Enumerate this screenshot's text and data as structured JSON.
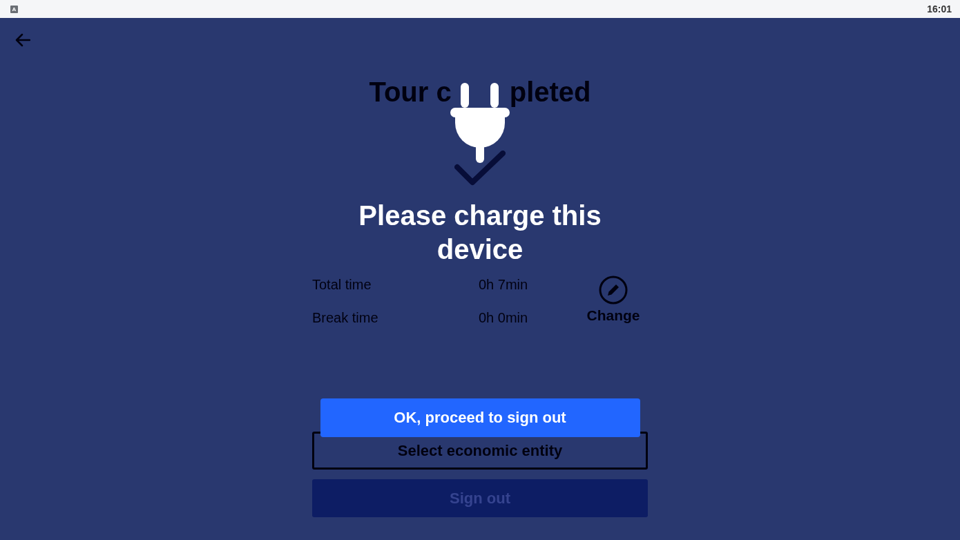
{
  "status_bar": {
    "badge": "A",
    "time": "16:01"
  },
  "summary": {
    "title_parts": [
      "Tour c",
      "pleted"
    ],
    "rows": [
      {
        "label": "Total time",
        "value": "0h 7min"
      },
      {
        "label": "Break time",
        "value": "0h 0min"
      }
    ],
    "change_label": "Change",
    "buttons": [
      {
        "label": "Select economic entity",
        "kind": "outline"
      },
      {
        "label": "Sign out",
        "kind": "filled"
      }
    ]
  },
  "dialog": {
    "message": "Please charge this device",
    "button": "OK, proceed to sign out"
  }
}
